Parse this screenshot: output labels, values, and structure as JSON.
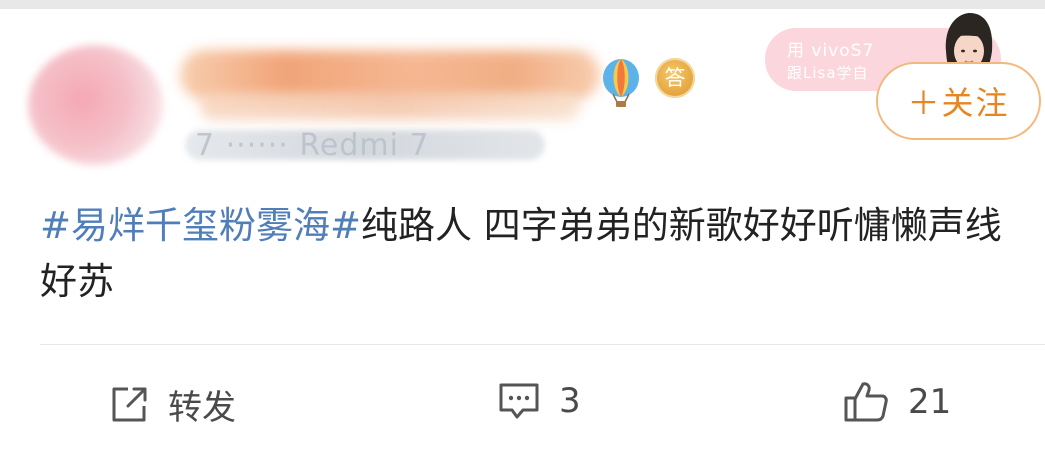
{
  "user": {
    "meta_partial": "7  ······  Redmi 7"
  },
  "badge": {
    "medal_char": "答"
  },
  "ad": {
    "line1": "用 vivoS7",
    "line2": "跟Lisa学自"
  },
  "follow_button": {
    "label": "＋关注"
  },
  "post": {
    "hashtag": "#易烊千玺粉雾海#",
    "text": "纯路人 四字弟弟的新歌好好听慵懒声线好苏"
  },
  "actions": {
    "repost_label": "转发",
    "comment_count": "3",
    "like_count": "21"
  },
  "icons": [
    "repost-icon",
    "comment-icon",
    "like-icon",
    "hot-air-balloon-icon",
    "medal-icon"
  ],
  "colors": {
    "hashtag": "#4f7eb9",
    "follow_text": "#e7851f",
    "follow_border": "#f3b97c",
    "ad_bg": "#fbd7dd"
  }
}
